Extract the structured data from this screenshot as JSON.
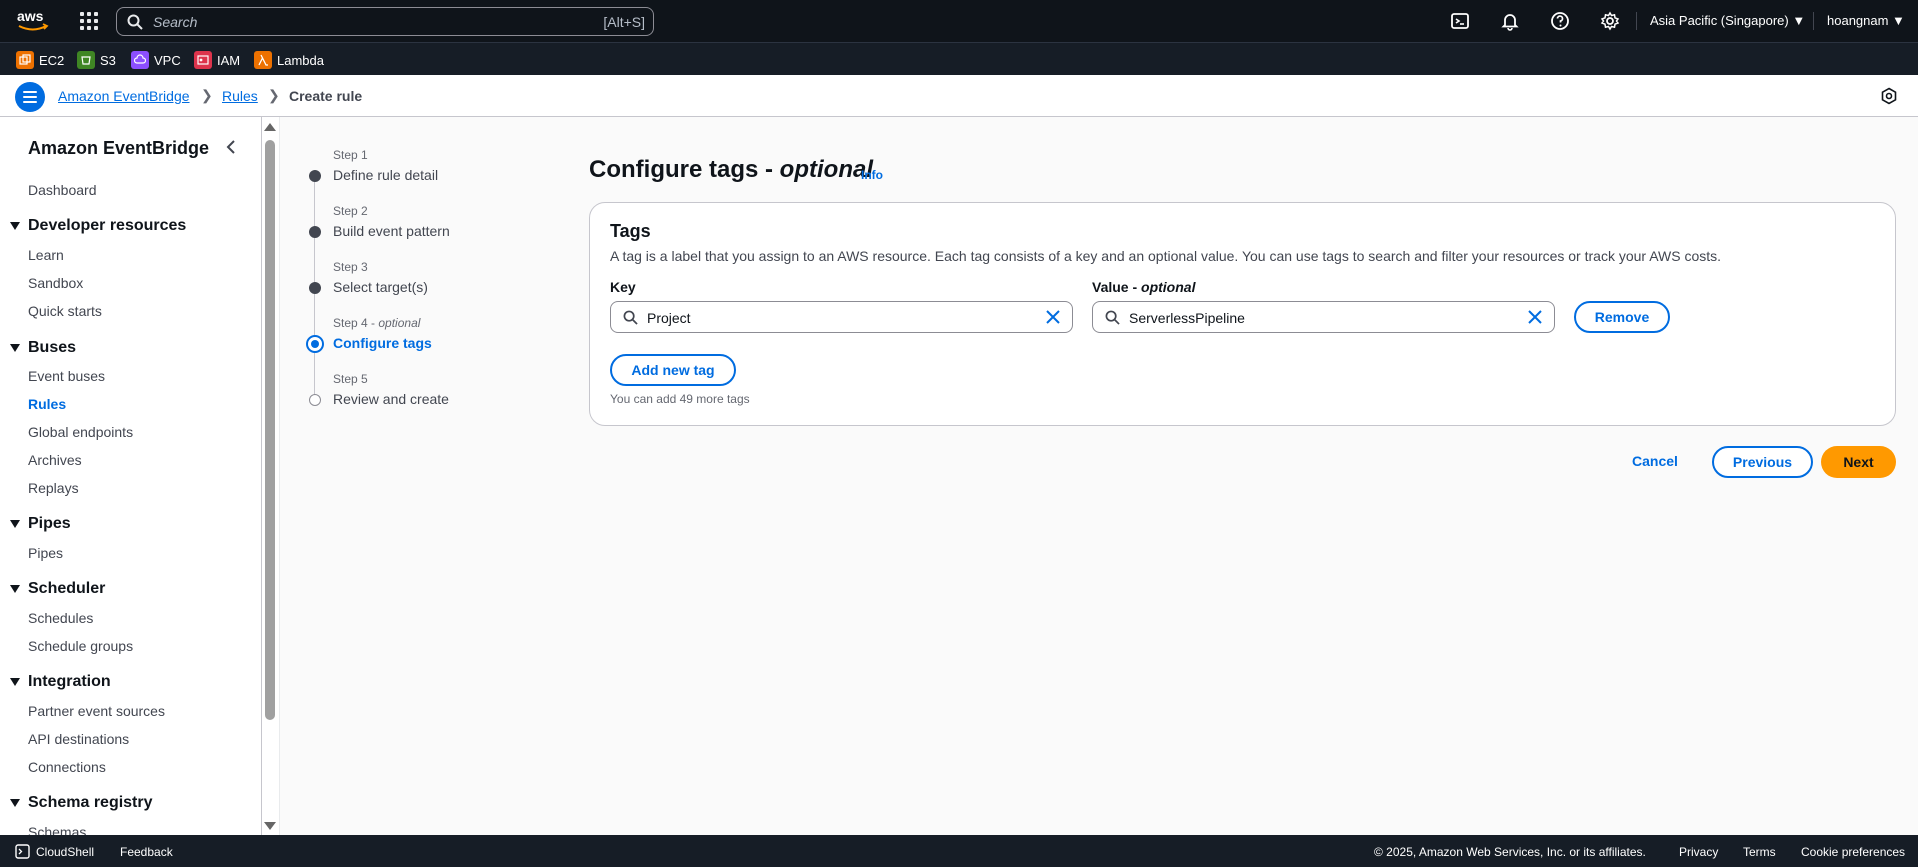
{
  "topnav": {
    "search_placeholder": "Search",
    "search_shortcut": "[Alt+S]",
    "region": "Asia Pacific (Singapore) ▼",
    "user": "hoangnam ▼"
  },
  "favorites": [
    {
      "label": "EC2",
      "color": "#ed7100"
    },
    {
      "label": "S3",
      "color": "#3f8624"
    },
    {
      "label": "VPC",
      "color": "#8c4fff"
    },
    {
      "label": "IAM",
      "color": "#dd344c"
    },
    {
      "label": "Lambda",
      "color": "#ed7100"
    }
  ],
  "breadcrumb": {
    "items": [
      "Amazon EventBridge",
      "Rules",
      "Create rule"
    ]
  },
  "sidebar": {
    "title": "Amazon EventBridge",
    "dashboard": "Dashboard",
    "sections": [
      {
        "title": "Developer resources",
        "items": [
          "Learn",
          "Sandbox",
          "Quick starts"
        ]
      },
      {
        "title": "Buses",
        "items": [
          "Event buses",
          "Rules",
          "Global endpoints",
          "Archives",
          "Replays"
        ]
      },
      {
        "title": "Pipes",
        "items": [
          "Pipes"
        ]
      },
      {
        "title": "Scheduler",
        "items": [
          "Schedules",
          "Schedule groups"
        ]
      },
      {
        "title": "Integration",
        "items": [
          "Partner event sources",
          "API destinations",
          "Connections"
        ]
      },
      {
        "title": "Schema registry",
        "items": [
          "Schemas"
        ]
      }
    ]
  },
  "steps": [
    {
      "label": "Step 1",
      "name": "Define rule detail"
    },
    {
      "label": "Step 2",
      "name": "Build event pattern"
    },
    {
      "label": "Step 3",
      "name": "Select target(s)"
    },
    {
      "label": "Step 4",
      "label_suffix": "optional",
      "name": "Configure tags"
    },
    {
      "label": "Step 5",
      "name": "Review and create"
    }
  ],
  "page": {
    "title": "Configure tags - ",
    "title_italic": "optional",
    "info": "Info"
  },
  "tags_panel": {
    "title": "Tags",
    "description": "A tag is a label that you assign to an AWS resource. Each tag consists of a key and an optional value. You can use tags to search and filter your resources or track your AWS costs.",
    "key_label": "Key",
    "value_label": "Value - ",
    "value_label_italic": "optional",
    "key_value": "Project",
    "value_value": "ServerlessPipeline",
    "remove": "Remove",
    "add_new_tag": "Add new tag",
    "hint": "You can add 49 more tags"
  },
  "actions": {
    "cancel": "Cancel",
    "previous": "Previous",
    "next": "Next"
  },
  "footer": {
    "cloudshell": "CloudShell",
    "feedback": "Feedback",
    "copyright": "© 2025, Amazon Web Services, Inc. or its affiliates.",
    "privacy": "Privacy",
    "terms": "Terms",
    "cookie": "Cookie preferences"
  },
  "colors": {
    "accent": "#006ce0",
    "primary_button": "#ff9900",
    "nav_bg": "#0f141a"
  }
}
